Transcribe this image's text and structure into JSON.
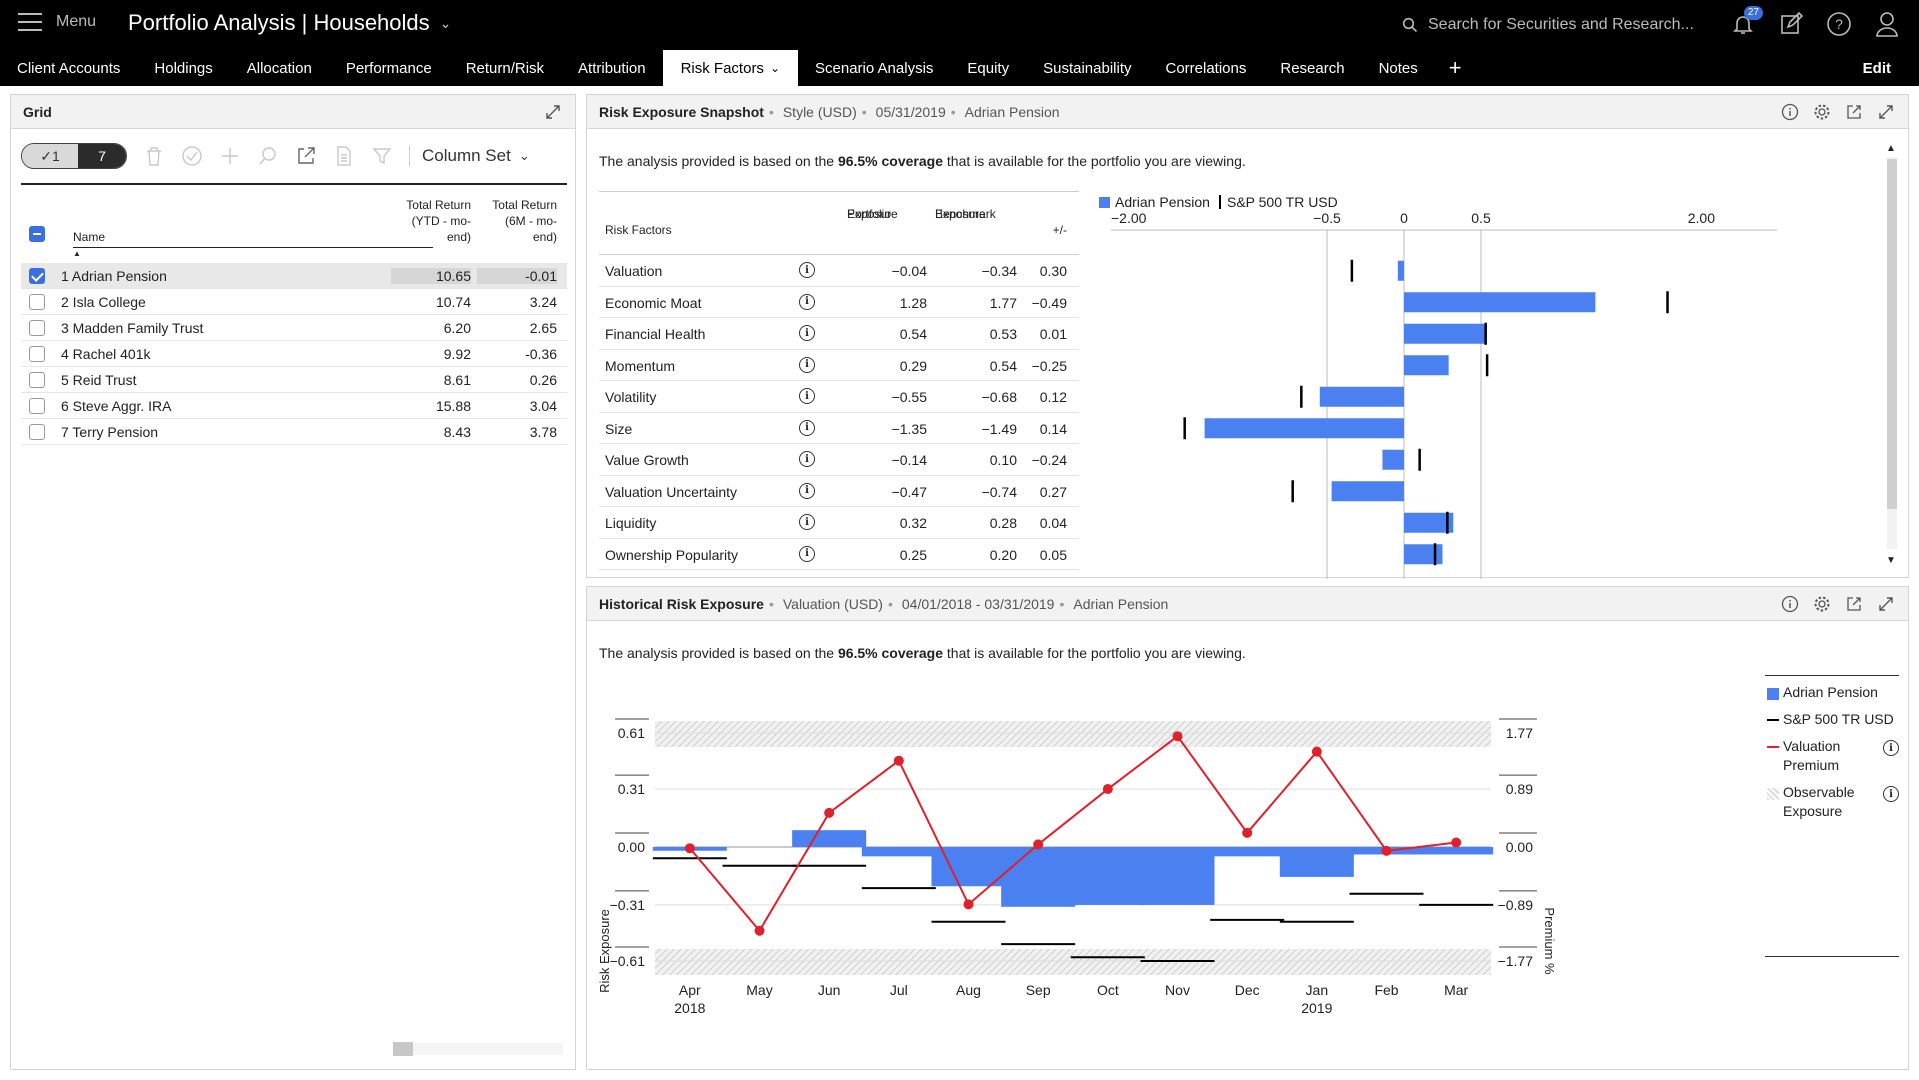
{
  "header": {
    "menu_label": "Menu",
    "app_title": "Portfolio Analysis | Households",
    "search_placeholder": "Search for Securities and Research...",
    "notifications_count": "27"
  },
  "tabs": [
    "Client Accounts",
    "Holdings",
    "Allocation",
    "Performance",
    "Return/Risk",
    "Attribution",
    "Risk Factors",
    "Scenario Analysis",
    "Equity",
    "Sustainability",
    "Correlations",
    "Research",
    "Notes"
  ],
  "active_tab": "Risk Factors",
  "edit_label": "Edit",
  "grid": {
    "title": "Grid",
    "toggle_selected": "✓1",
    "toggle_total": "7",
    "column_set": "Column Set",
    "headers": {
      "name": "Name",
      "ytd": [
        "Total Return",
        "(YTD - mo-",
        "end)"
      ],
      "six_m": [
        "Total Return",
        "(6M - mo-",
        "end)"
      ]
    },
    "rows": [
      {
        "name": "1  Adrian Pension",
        "ytd": "10.65",
        "m6": "-0.01",
        "selected": true
      },
      {
        "name": "2  Isla College",
        "ytd": "10.74",
        "m6": "3.24",
        "selected": false
      },
      {
        "name": "3  Madden Family Trust",
        "ytd": "6.20",
        "m6": "2.65",
        "selected": false
      },
      {
        "name": "4  Rachel 401k",
        "ytd": "9.92",
        "m6": "-0.36",
        "selected": false
      },
      {
        "name": "5  Reid Trust",
        "ytd": "8.61",
        "m6": "0.26",
        "selected": false
      },
      {
        "name": "6  Steve Aggr. IRA",
        "ytd": "15.88",
        "m6": "3.04",
        "selected": false
      },
      {
        "name": "7  Terry Pension",
        "ytd": "8.43",
        "m6": "3.78",
        "selected": false
      }
    ]
  },
  "snapshot": {
    "title": "Risk Exposure Snapshot",
    "meta": [
      "Style (USD)",
      "05/31/2019",
      "Adrian Pension"
    ],
    "coverage_pre": "The analysis provided is based on the ",
    "coverage_bold": "96.5% coverage",
    "coverage_post": " that is available for the portfolio you are viewing.",
    "col_risk_factors": "Risk Factors",
    "col_portfolio": [
      "Portfolio",
      "Exposure"
    ],
    "col_benchmark": [
      "Benchmark",
      "Exposure"
    ],
    "col_diff": "+/-",
    "legend": [
      "Adrian Pension",
      "S&P 500 TR USD"
    ],
    "colors": {
      "portfolio": "#4a80f0",
      "benchmark": "#000000"
    }
  },
  "historical": {
    "title": "Historical Risk Exposure",
    "meta": [
      "Valuation (USD)",
      "04/01/2018 - 03/31/2019",
      "Adrian Pension"
    ],
    "coverage_pre": "The analysis provided is based on the ",
    "coverage_bold": "96.5% coverage",
    "coverage_post": " that is available for the portfolio you are viewing.",
    "legend": [
      "Adrian Pension",
      "S&P 500 TR USD",
      "Valuation Premium",
      "Observable Exposure"
    ],
    "colors": {
      "portfolio": "#4a80f0",
      "benchmark": "#000000",
      "premium": "#e0202a"
    }
  },
  "chart_data": [
    {
      "type": "bar",
      "orientation": "horizontal",
      "categories": [
        "Valuation",
        "Economic Moat",
        "Financial Health",
        "Momentum",
        "Volatility",
        "Size",
        "Value Growth",
        "Valuation Uncertainty",
        "Liquidity",
        "Ownership Popularity"
      ],
      "series": [
        {
          "name": "Adrian Pension",
          "values": [
            -0.04,
            1.28,
            0.54,
            0.29,
            -0.55,
            -1.35,
            -0.14,
            -0.47,
            0.32,
            0.25
          ]
        },
        {
          "name": "S&P 500 TR USD",
          "values": [
            -0.34,
            1.77,
            0.53,
            0.54,
            -0.68,
            -1.49,
            0.1,
            -0.74,
            0.28,
            0.2
          ]
        }
      ],
      "diff": [
        0.3,
        -0.49,
        0.01,
        -0.25,
        0.12,
        0.14,
        -0.24,
        0.27,
        0.04,
        0.05
      ],
      "portfolio_labels": [
        "−0.04",
        "1.28",
        "0.54",
        "0.29",
        "−0.55",
        "−1.35",
        "−0.14",
        "−0.47",
        "0.32",
        "0.25"
      ],
      "benchmark_labels": [
        "−0.34",
        "1.77",
        "0.53",
        "0.54",
        "−0.68",
        "−1.49",
        "0.10",
        "−0.74",
        "0.28",
        "0.20"
      ],
      "diff_labels": [
        "0.30",
        "−0.49",
        "0.01",
        "−0.25",
        "0.12",
        "0.14",
        "−0.24",
        "0.27",
        "0.04",
        "0.05"
      ],
      "x_ticks": [
        "−2.00",
        "−0.5",
        "0",
        "0.5",
        "2.00"
      ],
      "x_tick_values": [
        -2.0,
        -0.5,
        0,
        0.5,
        2.0
      ],
      "xlim": [
        -2.0,
        2.0
      ],
      "grid": true
    },
    {
      "type": "bar",
      "categories": [
        "Apr",
        "May",
        "Jun",
        "Jul",
        "Aug",
        "Sep",
        "Oct",
        "Nov",
        "Dec",
        "Jan",
        "Feb",
        "Mar"
      ],
      "year_labels": {
        "Apr": "2018",
        "Jan": "2019"
      },
      "series": [
        {
          "name": "Adrian Pension",
          "type": "bar",
          "values": [
            -0.02,
            0.0,
            0.09,
            -0.05,
            -0.21,
            -0.32,
            -0.31,
            -0.31,
            -0.05,
            -0.16,
            -0.04,
            -0.04
          ]
        },
        {
          "name": "S&P 500 TR USD",
          "type": "marker",
          "values": [
            -0.06,
            -0.1,
            -0.1,
            -0.22,
            -0.4,
            -0.52,
            -0.59,
            -0.61,
            -0.39,
            -0.4,
            -0.25,
            -0.31
          ]
        },
        {
          "name": "Valuation Premium",
          "type": "line",
          "axis": "right",
          "values": [
            -0.02,
            -1.3,
            0.53,
            1.34,
            -0.89,
            0.04,
            0.9,
            1.72,
            0.22,
            1.48,
            -0.06,
            0.07
          ]
        }
      ],
      "ylabel": "Risk Exposure",
      "y2label": "Premium %",
      "yticks": [
        "0.61",
        "0.31",
        "0.00",
        "−0.31",
        "−0.61"
      ],
      "y2ticks": [
        "1.77",
        "0.89",
        "0.00",
        "−0.89",
        "−1.77"
      ],
      "ylim": [
        -0.61,
        0.61
      ],
      "y2lim": [
        -1.77,
        1.77
      ],
      "grid": true
    }
  ]
}
